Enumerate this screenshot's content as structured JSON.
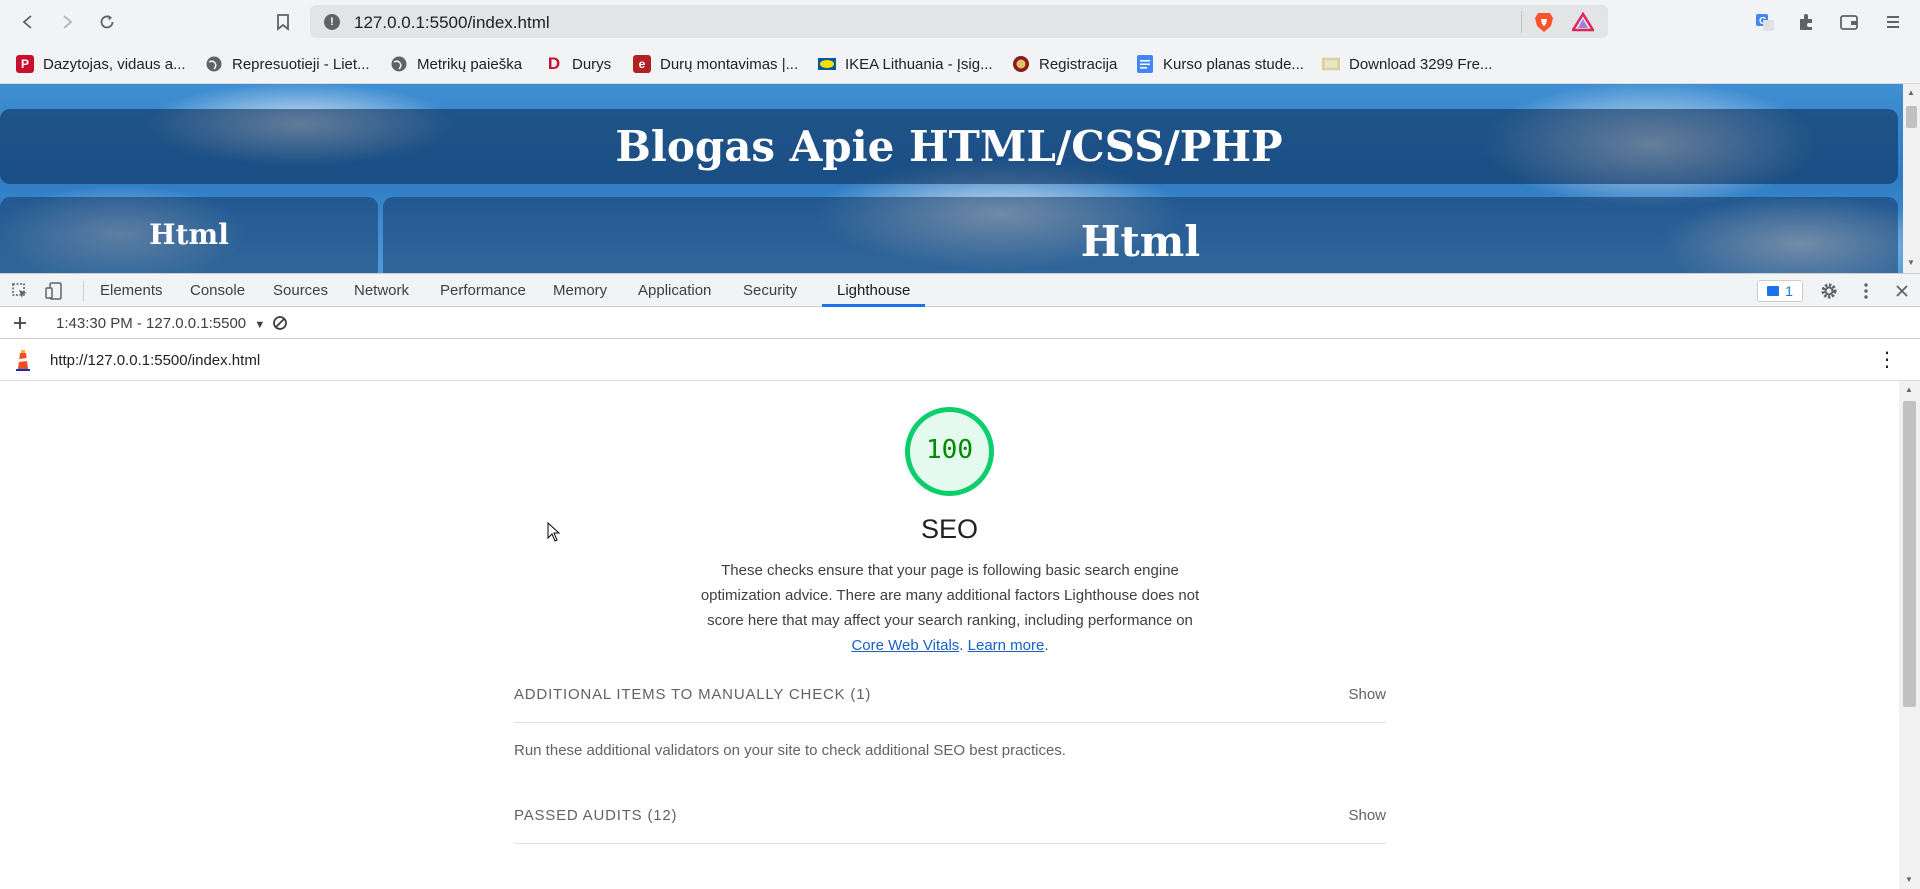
{
  "browser": {
    "url": "127.0.0.1:5500/index.html",
    "bookmarks": [
      {
        "label": "Dazytojas, vidaus a...",
        "icon": "P",
        "color": "#c8102e"
      },
      {
        "label": "Represuotieji - Liet...",
        "icon": "globe",
        "color": "#5f6368"
      },
      {
        "label": "Metrikų paieška",
        "icon": "globe",
        "color": "#5f6368"
      },
      {
        "label": "Durys",
        "icon": "D",
        "color": "#c8102e"
      },
      {
        "label": "Durų montavimas |...",
        "icon": "e",
        "color": "#b22222"
      },
      {
        "label": "IKEA Lithuania - Įsig...",
        "icon": "ikea",
        "color": "#0058a3"
      },
      {
        "label": "Registracija",
        "icon": "seal",
        "color": "#8b1a1a"
      },
      {
        "label": "Kurso planas stude...",
        "icon": "doc",
        "color": "#4285f4"
      },
      {
        "label": "Download 3299 Fre...",
        "icon": "img",
        "color": "#d8d2a0"
      }
    ]
  },
  "page": {
    "title": "Blogas Apie HTML/CSS/PHP",
    "left_heading": "Html",
    "right_heading": "Html"
  },
  "devtools": {
    "tabs": [
      "Elements",
      "Console",
      "Sources",
      "Network",
      "Performance",
      "Memory",
      "Application",
      "Security",
      "Lighthouse"
    ],
    "active_tab": "Lighthouse",
    "issues_count": "1",
    "report_select": "1:43:30 PM - 127.0.0.1:5500",
    "report_url": "http://127.0.0.1:5500/index.html"
  },
  "lighthouse": {
    "score": "100",
    "score_color": "#0cce6b",
    "category": "SEO",
    "description": "These checks ensure that your page is following basic search engine optimization advice. There are many additional factors Lighthouse does not score here that may affect your search ranking, including performance on",
    "link_core": "Core Web Vitals",
    "link_sep": ". ",
    "link_learn": "Learn more",
    "link_end": ".",
    "manual_heading": "ADDITIONAL ITEMS TO MANUALLY CHECK (1)",
    "manual_show": "Show",
    "manual_text": "Run these additional validators on your site to check additional SEO best practices.",
    "passed_heading": "PASSED AUDITS (12)",
    "passed_show": "Show"
  }
}
